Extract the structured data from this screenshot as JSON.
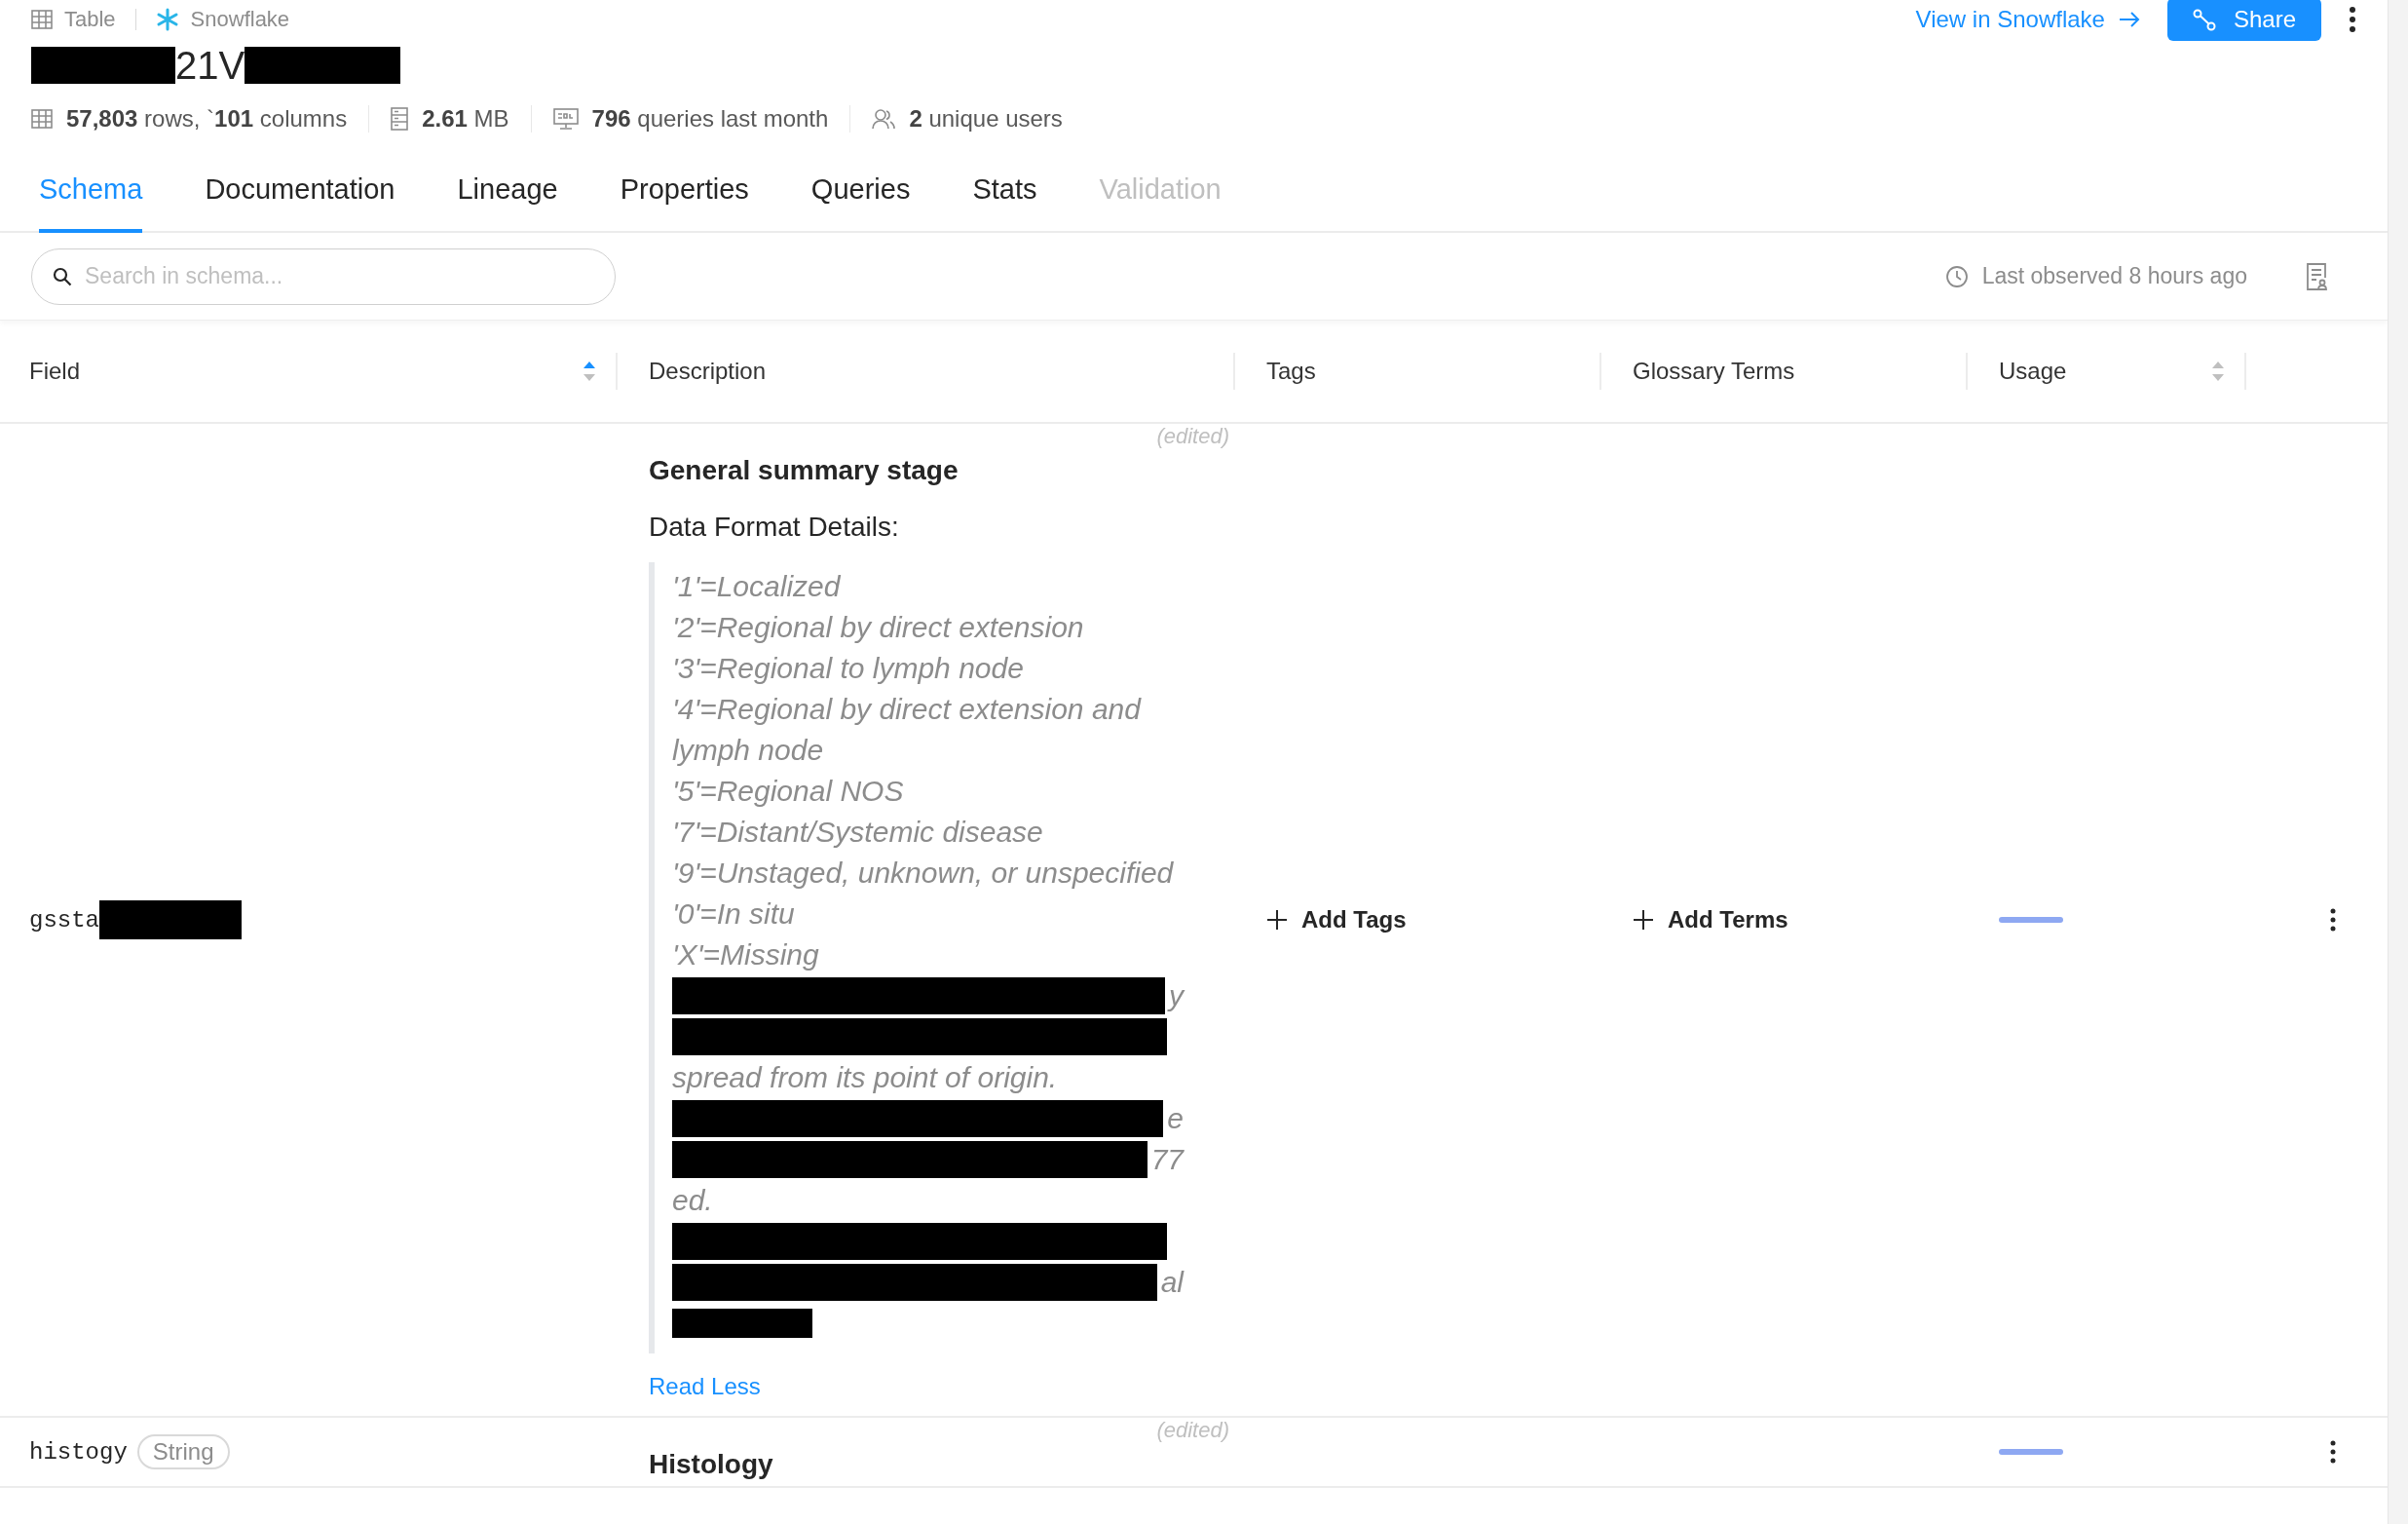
{
  "breadcrumb": [
    {
      "label": "Table"
    },
    {
      "label": "Snowflake"
    }
  ],
  "title": {
    "text": "21V",
    "redacted_before": true,
    "redacted_after": true
  },
  "actions": {
    "link": "View in Snowflake",
    "share": "Share"
  },
  "stats": [
    {
      "text": "**57,803** rows, `**101** columns"
    },
    {
      "text": "**2.61** MB"
    },
    {
      "text": "**796** queries last month"
    },
    {
      "text": "**2** unique users"
    }
  ],
  "tabs": [
    {
      "label": "Schema",
      "selected": true,
      "disabled": false
    },
    {
      "label": "Documentation",
      "selected": false,
      "disabled": false
    },
    {
      "label": "Lineage",
      "selected": false,
      "disabled": false
    },
    {
      "label": "Properties",
      "selected": false,
      "disabled": false
    },
    {
      "label": "Queries",
      "selected": false,
      "disabled": false
    },
    {
      "label": "Stats",
      "selected": false,
      "disabled": false
    },
    {
      "label": "Validation",
      "selected": false,
      "disabled": true
    }
  ],
  "toolbar": {
    "search": {
      "placeholder": "Search in schema..."
    },
    "last_observed": "Last observed 8 hours ago"
  },
  "table": {
    "columns": [
      {
        "label": "Field",
        "kind": "sortable",
        "sorted": true
      },
      {
        "label": "Description",
        "kind": "plain"
      },
      {
        "label": "Tags",
        "kind": "plain"
      },
      {
        "label": "Glossary Terms",
        "kind": "plain"
      },
      {
        "label": "Usage",
        "kind": "sortable",
        "sorted": false
      }
    ],
    "rows": [
      {
        "field": "gssta",
        "field_redacted": true,
        "description": {
          "edited": "(edited)",
          "title": "General summary stage",
          "subtitle": "Data Format Details:",
          "lines": [
            {
              "kind": "text",
              "text": "'1'=Localized"
            },
            {
              "kind": "text",
              "text": "'2'=Regional by direct extension"
            },
            {
              "kind": "text",
              "text": "'3'=Regional to lymph node"
            },
            {
              "kind": "text",
              "text": "'4'=Regional by direct extension and lymph node"
            },
            {
              "kind": "text",
              "text": "'5'=Regional NOS"
            },
            {
              "kind": "text",
              "text": "'7'=Distant/Systemic disease"
            },
            {
              "kind": "text",
              "text": "'9'=Unstaged, unknown, or unspecified"
            },
            {
              "kind": "text",
              "text": "'0'=In situ"
            },
            {
              "kind": "text",
              "text": "'X'=Missing"
            },
            {
              "kind": "redacted",
              "tail": "y"
            },
            {
              "kind": "redacted"
            },
            {
              "kind": "text",
              "text": "spread from its point of origin."
            },
            {
              "kind": "redacted",
              "tail": "e"
            },
            {
              "kind": "redacted",
              "tail": "77"
            },
            {
              "kind": "text",
              "text": "ed."
            },
            {
              "kind": "redacted"
            },
            {
              "kind": "redacted",
              "tail": "al"
            },
            {
              "kind": "redacted_short"
            }
          ],
          "toggle": "Read Less"
        },
        "add_tags": "Add Tags",
        "add_terms": "Add Terms"
      },
      {
        "field": "histogy",
        "type": "String",
        "description": {
          "edited": "(edited)",
          "title": "Histology"
        }
      }
    ]
  }
}
